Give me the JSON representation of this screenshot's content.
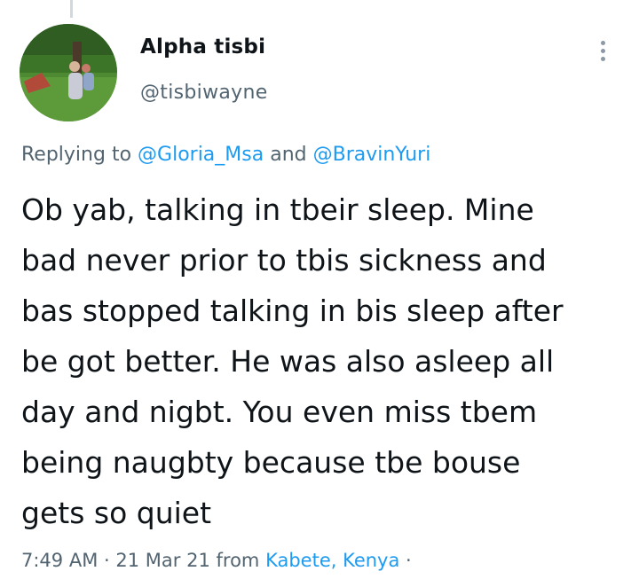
{
  "author": {
    "display_name": "Alpha tisbi",
    "handle": "@tisbiwayne",
    "avatar_icon": "profile-photo"
  },
  "menu": {
    "icon": "more-vertical-icon"
  },
  "reply": {
    "prefix": "Replying to",
    "user1": "@Gloria_Msa",
    "joiner": "and",
    "user2": "@BravinYuri"
  },
  "tweet": {
    "text": "Ob yab, talking in tbeir sleep. Mine\nbad never prior to tbis sickness and\nbas stopped talking in bis sleep after\nbe got better. He was also asleep all\nday and nigbt. You even miss tbem\nbeing naugbty because tbe bouse\ngets so quiet"
  },
  "meta": {
    "time": "7:49 AM",
    "separator": "·",
    "date": "21 Mar 21",
    "from_label": "from",
    "location": "Kabete, Kenya",
    "trailing": "·"
  },
  "colors": {
    "link": "#1d9bf0",
    "secondary": "#536471",
    "primary": "#0f1419"
  }
}
